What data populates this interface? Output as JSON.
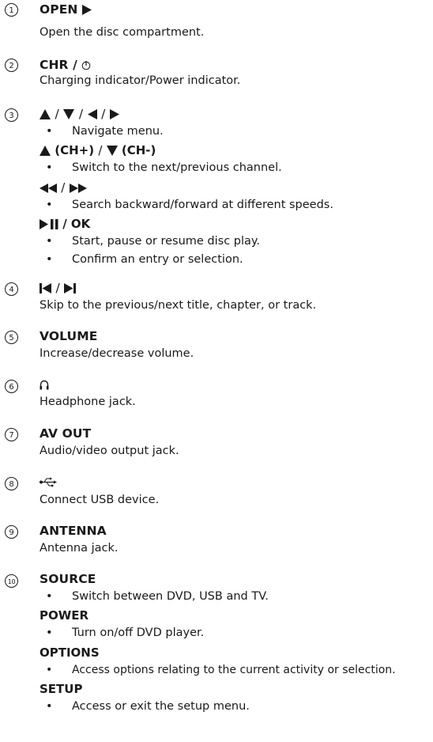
{
  "bullet_char": "•",
  "items": [
    {
      "n": "1",
      "title": "OPEN",
      "desc": "Open the disc compartment."
    },
    {
      "n": "2",
      "title": "CHR /",
      "desc": "Charging indicator/Power indicator."
    },
    {
      "n": "3",
      "sep1": "/",
      "sep2": "/",
      "sep3": "/",
      "b1": "Navigate menu.",
      "ch_plus": "(CH+)",
      "ch_minus": "(CH-)",
      "sep4": "/",
      "b2": "Switch to the next/previous channel.",
      "sep5": "/",
      "b3": "Search backward/forward at different speeds.",
      "ok": "/ OK",
      "b4": "Start, pause or resume disc play.",
      "b5": "Confirm an entry or selection."
    },
    {
      "n": "4",
      "sep": "/",
      "desc": "Skip to the previous/next title, chapter, or track."
    },
    {
      "n": "5",
      "title": "VOLUME",
      "desc": "Increase/decrease volume."
    },
    {
      "n": "6",
      "desc": "Headphone jack."
    },
    {
      "n": "7",
      "title": "AV OUT",
      "desc": "Audio/video output jack."
    },
    {
      "n": "8",
      "desc": "Connect USB device."
    },
    {
      "n": "9",
      "title": "ANTENNA",
      "desc": "Antenna jack."
    },
    {
      "n": "10",
      "title": "SOURCE",
      "b1": "Switch between DVD, USB and TV.",
      "sub2": "POWER",
      "b2": "Turn on/off DVD player.",
      "sub3": "OPTIONS",
      "b3": "Access options relating to the current activity or selection.",
      "sub4": "SETUP",
      "b4": "Access or exit the setup menu."
    }
  ]
}
